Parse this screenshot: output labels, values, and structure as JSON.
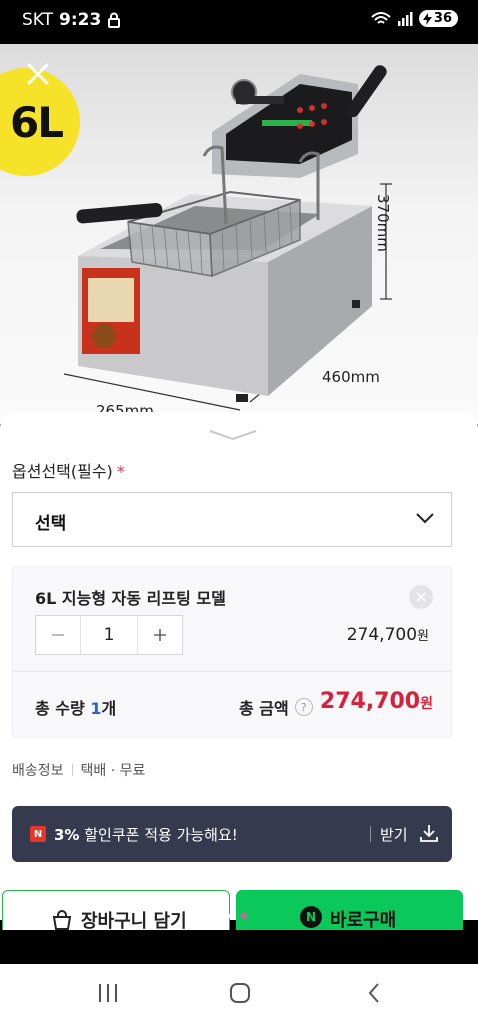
{
  "status_bar": {
    "carrier": "SKT",
    "time": "9:23",
    "battery": "36"
  },
  "product": {
    "capacity_badge": "6L",
    "dimension_height": "370mm",
    "dimension_width": "460mm",
    "dimension_depth": "265mm"
  },
  "options": {
    "label": "옵션선택(필수)",
    "required_mark": "*",
    "select_value": "선택"
  },
  "selected_item": {
    "name": "6L 지능형 자동 리프팅 모델",
    "quantity": "1",
    "price": "274,700",
    "price_unit": "원"
  },
  "summary": {
    "total_qty_label": "총 수량",
    "total_qty_value": "1",
    "total_qty_unit": "개",
    "total_amount_label": "총 금액",
    "help": "?",
    "total_amount": "274,700",
    "total_amount_unit": "원"
  },
  "shipping": {
    "label": "배송정보",
    "value": "택배 · 무료"
  },
  "coupon": {
    "badge": "N",
    "percent": "3%",
    "text": "할인쿠폰 적용 가능해요!",
    "receive_label": "받기"
  },
  "actions": {
    "cart_label": "장바구니 담기",
    "buy_badge": "N",
    "buy_label": "바로구매"
  },
  "colors": {
    "accent_red": "#d8213b",
    "buy_green": "#0bc85a",
    "coupon_bg": "#363a4f",
    "badge_yellow": "#f7e22a"
  }
}
